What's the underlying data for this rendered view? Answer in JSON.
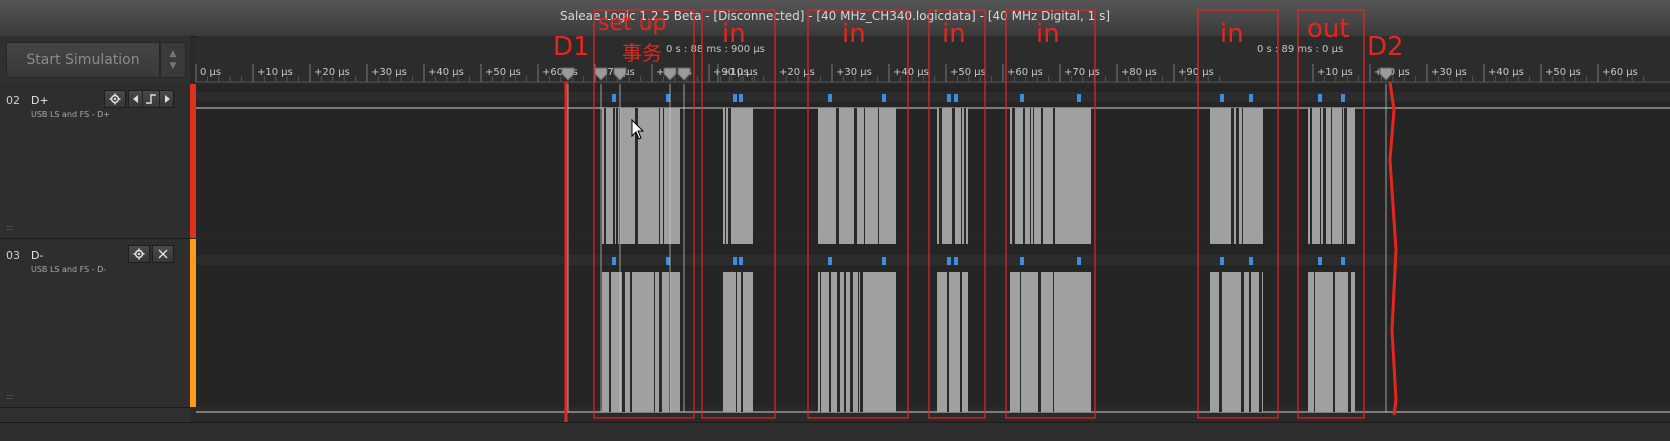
{
  "window": {
    "title": "Saleae Logic 1.2.5 Beta - [Disconnected] - [40 MHz_CH340.logicdata] - [40 MHz Digital, 1 s]"
  },
  "toolbar": {
    "start_simulation": "Start Simulation",
    "up_arrow": "▲",
    "down_arrow": "▼"
  },
  "timeline": {
    "abs_time_1": "0 s : 88 ms : 900 μs",
    "abs_time_2": "0 s : 89 ms : 0 μs",
    "ticks_group_1": [
      "0 μs",
      "+10 μs",
      "+20 μs",
      "+30 μs",
      "+40 μs",
      "+50 μs",
      "+60 μs",
      "+70 μs",
      "+80 μs",
      "+90 μs"
    ],
    "ticks_group_2": [
      "+10 μs",
      "+20 μs",
      "+30 μs",
      "+40 μs",
      "+50 μs",
      "+60 μs",
      "+70 μs",
      "+80 μs",
      "+90 μs"
    ],
    "ticks_group_3": [
      "+10 μs",
      "+20 μs",
      "+30 μs",
      "+40 μs",
      "+50 μs",
      "+60 μs"
    ]
  },
  "channels": [
    {
      "num": "02",
      "name": "D+",
      "sub": "USB LS and FS - D+",
      "color": "#e0301e"
    },
    {
      "num": "03",
      "name": "D-",
      "sub": "USB LS and FS - D-",
      "color": "#ff9a1a"
    }
  ],
  "annotations": {
    "d1": "D1",
    "d2": "D2",
    "setup": "set up",
    "setup_sub": "事务",
    "in": "in",
    "out": "out",
    "color": "#e8251d"
  },
  "icons": {
    "gear": "gear-icon",
    "arrow_left": "arrow-left-icon",
    "trigger": "trigger-icon",
    "arrow_right": "arrow-right-icon",
    "close": "close-icon",
    "grip": "grip-icon",
    "cursor": "mouse-cursor-icon"
  }
}
